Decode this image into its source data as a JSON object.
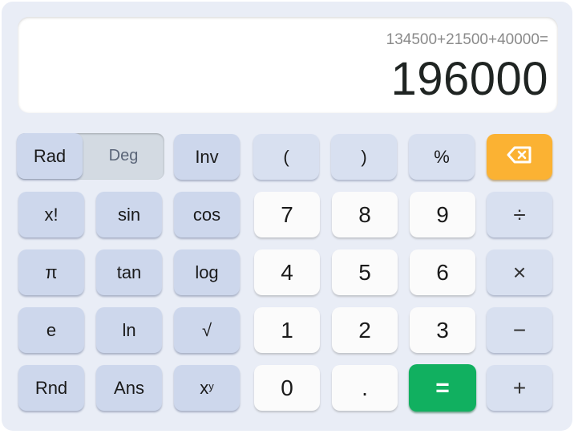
{
  "display": {
    "expression": "134500+21500+40000=",
    "result": "196000"
  },
  "angle_toggle": {
    "rad_label": "Rad",
    "deg_label": "Deg",
    "selected": "Rad"
  },
  "buttons": {
    "inv": "Inv",
    "lparen": "(",
    "rparen": ")",
    "percent": "%",
    "backspace_icon": "backspace-icon",
    "factorial": "x!",
    "sin": "sin",
    "cos": "cos",
    "seven": "7",
    "eight": "8",
    "nine": "9",
    "divide": "÷",
    "pi": "π",
    "tan": "tan",
    "log": "log",
    "four": "4",
    "five": "5",
    "six": "6",
    "multiply": "×",
    "e": "e",
    "ln": "ln",
    "sqrt": "√",
    "one": "1",
    "two": "2",
    "three": "3",
    "minus": "−",
    "rnd": "Rnd",
    "ans": "Ans",
    "power_base": "x",
    "power_exp": "y",
    "zero": "0",
    "dot": ".",
    "equals": "=",
    "plus": "+"
  },
  "colors": {
    "equals": "#11b060",
    "backspace": "#fbb233",
    "function_key": "#cdd7ec",
    "number_key": "#fbfbfb"
  }
}
